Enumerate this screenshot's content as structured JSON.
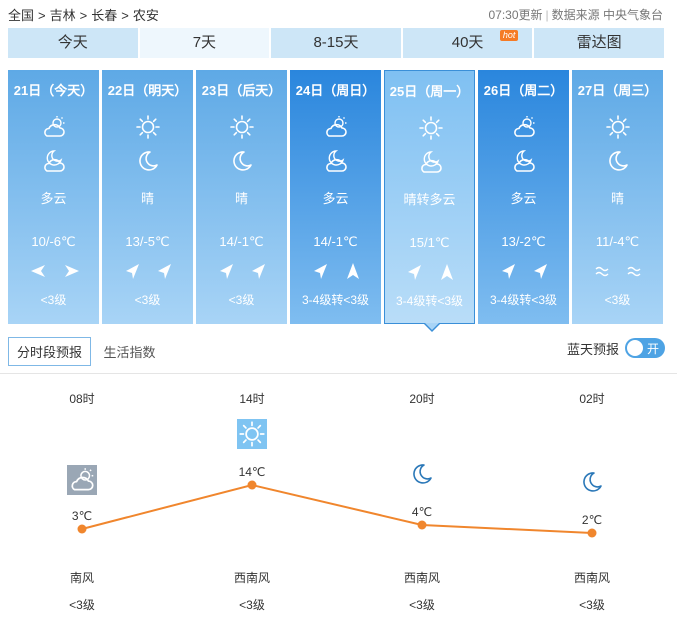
{
  "breadcrumb": {
    "items": [
      "全国",
      ">",
      "吉林",
      ">",
      "长春",
      ">",
      "农安"
    ]
  },
  "meta": {
    "update": "07:30更新",
    "source": "数据来源 中央气象台"
  },
  "tabs": [
    {
      "label": "今天"
    },
    {
      "label": "7天"
    },
    {
      "label": "8-15天"
    },
    {
      "label": "40天",
      "badge": "hot"
    },
    {
      "label": "雷达图"
    }
  ],
  "days": [
    {
      "date": "21日（今天）",
      "icon_day": "partly-cloudy-icon",
      "icon_night": "cloudy-moon-icon",
      "cond": "多云",
      "temp": "10/-6℃",
      "wind_day": "arrow-left-icon",
      "wind_night": "arrow-right-icon",
      "level": "<3级"
    },
    {
      "date": "22日（明天）",
      "icon_day": "sun-icon",
      "icon_night": "moon-icon",
      "cond": "晴",
      "temp": "13/-5℃",
      "wind_day": "arrow-ne-icon",
      "wind_night": "arrow-ne-icon",
      "level": "<3级"
    },
    {
      "date": "23日（后天）",
      "icon_day": "sun-icon",
      "icon_night": "moon-icon",
      "cond": "晴",
      "temp": "14/-1℃",
      "wind_day": "arrow-ne-icon",
      "wind_night": "arrow-ne-icon",
      "level": "<3级"
    },
    {
      "date": "24日（周日）",
      "icon_day": "partly-cloudy-icon",
      "icon_night": "cloudy-moon-icon",
      "cond": "多云",
      "temp": "14/-1℃",
      "wind_day": "arrow-ne-icon",
      "wind_night": "arrow-up-icon",
      "level": "3-4级转<3级"
    },
    {
      "date": "25日（周一）",
      "icon_day": "sun-icon",
      "icon_night": "cloudy-moon-icon",
      "cond": "晴转多云",
      "temp": "15/1℃",
      "wind_day": "arrow-ne-icon",
      "wind_night": "arrow-up-icon",
      "level": "3-4级转<3级"
    },
    {
      "date": "26日（周二）",
      "icon_day": "partly-cloudy-icon",
      "icon_night": "cloudy-moon-icon",
      "cond": "多云",
      "temp": "13/-2℃",
      "wind_day": "arrow-ne-icon",
      "wind_night": "arrow-ne-icon",
      "level": "3-4级转<3级"
    },
    {
      "date": "27日（周三）",
      "icon_day": "sun-icon",
      "icon_night": "moon-icon",
      "cond": "晴",
      "temp": "11/-4℃",
      "wind_day": "wave-icon",
      "wind_night": "wave-icon",
      "level": "<3级"
    }
  ],
  "subtabs": [
    {
      "label": "分时段预报"
    },
    {
      "label": "生活指数"
    }
  ],
  "bluesky": {
    "label": "蓝天预报",
    "toggle": "开"
  },
  "hourly": [
    {
      "time": "08时",
      "icon": "partly-cloudy-icon",
      "temp": "3℃",
      "temp_value": 3,
      "wind": "南风",
      "level": "<3级"
    },
    {
      "time": "14时",
      "icon": "sun-icon",
      "temp": "14℃",
      "temp_value": 14,
      "wind": "西南风",
      "level": "<3级"
    },
    {
      "time": "20时",
      "icon": "moon-icon",
      "temp": "4℃",
      "temp_value": 4,
      "wind": "西南风",
      "level": "<3级"
    },
    {
      "time": "02时",
      "icon": "moon-icon",
      "temp": "2℃",
      "temp_value": 2,
      "wind": "西南风",
      "level": "<3级"
    }
  ],
  "colors": {
    "line": "#f0862d",
    "point": "#f0862d",
    "day_dark": "#3a8fd8",
    "day_light": "#a8d4f6"
  }
}
